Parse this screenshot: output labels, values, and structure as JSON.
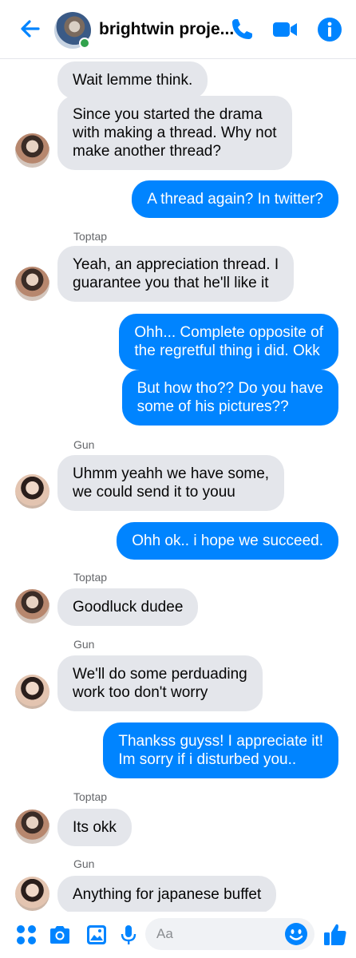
{
  "header": {
    "title": "brightwin proje...",
    "back_icon": "arrow-left-icon",
    "call_icon": "phone-icon",
    "video_icon": "video-camera-icon",
    "info_icon": "info-icon",
    "accent_color": "#0084ff",
    "online_color": "#31a24c"
  },
  "messages": [
    {
      "side": "left",
      "sender": "",
      "text": "Wait lemme think."
    },
    {
      "side": "left",
      "sender": "",
      "text": "Since you started the drama with making a thread. Why not make another thread?"
    },
    {
      "side": "right",
      "text": "A thread again? In twitter?"
    },
    {
      "side": "left",
      "sender": "Toptap",
      "text": "Yeah, an appreciation thread. I guarantee you that he'll like it"
    },
    {
      "side": "right",
      "text": "Ohh... Complete opposite of the regretful thing i did. Okk"
    },
    {
      "side": "right",
      "text": "But how tho?? Do you have some of his pictures??"
    },
    {
      "side": "left",
      "sender": "Gun",
      "text": "Uhmm yeahh we have some, we could send it to youu"
    },
    {
      "side": "right",
      "text": "Ohh ok.. i hope we succeed."
    },
    {
      "side": "left",
      "sender": "Toptap",
      "text": "Goodluck dudee"
    },
    {
      "side": "left",
      "sender": "Gun",
      "text": "We'll do some perduading work too don't worry"
    },
    {
      "side": "right",
      "text": "Thankss guyss! I appreciate it! Im sorry if i disturbed you.."
    },
    {
      "side": "left",
      "sender": "Toptap",
      "text": "Its okk"
    },
    {
      "side": "left",
      "sender": "Gun",
      "text": "Anything for japanese buffet"
    }
  ],
  "bubble_lines": {
    "m0": [
      "Wait lemme think."
    ],
    "m1": [
      "Since you started the drama",
      "with making a thread. Why not",
      "make another thread?"
    ],
    "m2": [
      "A thread again? In twitter?"
    ],
    "m3": [
      "Yeah, an appreciation thread. I",
      "guarantee you that he'll like it"
    ],
    "m4": [
      "Ohh... Complete opposite of",
      "the regretful thing i did. Okk"
    ],
    "m5": [
      "But how tho?? Do you have",
      "some of his pictures??"
    ],
    "m6": [
      "Uhmm yeahh we have some,",
      "we could send it to youu"
    ],
    "m7": [
      "Ohh ok.. i hope we succeed."
    ],
    "m8": [
      "Goodluck dudee"
    ],
    "m9": [
      "We'll do some perduading",
      "work too don't worry"
    ],
    "m10": [
      "Thankss guyss! I appreciate it!",
      "Im sorry if i disturbed you.."
    ],
    "m11": [
      "Its okk"
    ],
    "m12": [
      "Anything for japanese buffet"
    ]
  },
  "senders": {
    "s1": "Toptap",
    "s2": "Gun",
    "s3": "Toptap",
    "s4": "Gun",
    "s5": "Toptap",
    "s6": "Gun"
  },
  "footer": {
    "composer_placeholder": "Aa",
    "menu_icon": "four-dots-menu-icon",
    "camera_icon": "camera-icon",
    "gallery_icon": "image-icon",
    "mic_icon": "microphone-icon",
    "emoji_icon": "smiley-icon",
    "like_icon": "thumbs-up-icon"
  }
}
